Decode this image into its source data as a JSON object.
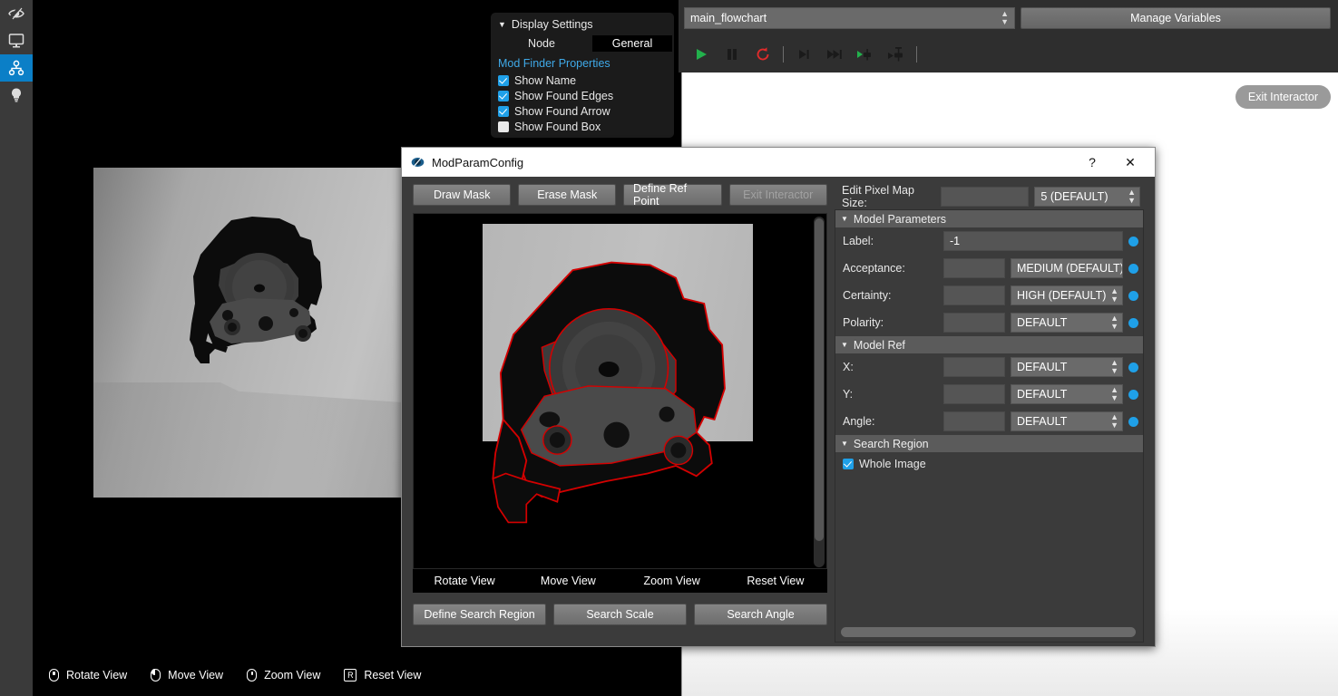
{
  "rail": {
    "items": [
      {
        "name": "vision-eye-icon",
        "label": "Vision",
        "active": false
      },
      {
        "name": "monitor-icon",
        "label": "Display",
        "active": false
      },
      {
        "name": "flowchart-nodes-icon",
        "label": "Flowchart",
        "active": true
      },
      {
        "name": "lightbulb-icon",
        "label": "Hints",
        "active": false
      }
    ]
  },
  "display_settings": {
    "title": "Display Settings",
    "triangle": "▼",
    "node_label": "Node",
    "general_tab": "General",
    "section_label": "Mod Finder Properties",
    "checkboxes": [
      {
        "label": "Show Name",
        "checked": true
      },
      {
        "label": "Show Found Edges",
        "checked": true
      },
      {
        "label": "Show Found Arrow",
        "checked": true
      },
      {
        "label": "Show Found Box",
        "checked": false
      }
    ]
  },
  "toolbar": {
    "flowchart_value": "main_flowchart",
    "manage_variables_label": "Manage Variables",
    "exit_interactor_label": "Exit Interactor",
    "buttons": [
      {
        "name": "run-button",
        "title": "Run"
      },
      {
        "name": "pause-button",
        "title": "Pause"
      },
      {
        "name": "reset-button",
        "title": "Reset"
      },
      {
        "name": "step-into-button",
        "title": "Step Into"
      },
      {
        "name": "step-over-button",
        "title": "Step Over"
      },
      {
        "name": "run-to-node-button",
        "title": "Run To Node"
      },
      {
        "name": "run-from-node-button",
        "title": "Run From Node"
      }
    ]
  },
  "viewport_legend": [
    {
      "icon": "mouse-rotate-icon",
      "label": "Rotate View"
    },
    {
      "icon": "mouse-move-icon",
      "label": "Move View"
    },
    {
      "icon": "mouse-zoom-icon",
      "label": "Zoom View"
    },
    {
      "icon": "key-r-icon",
      "label": "Reset View",
      "key": "R"
    }
  ],
  "dialog": {
    "title": "ModParamConfig",
    "icon": "eye-icon",
    "help_glyph": "?",
    "close_glyph": "✕",
    "tools": [
      {
        "label": "Draw Mask",
        "enabled": true
      },
      {
        "label": "Erase Mask",
        "enabled": true
      },
      {
        "label": "Define Ref Point",
        "enabled": true
      },
      {
        "label": "Exit Interactor",
        "enabled": false
      }
    ],
    "view_legend": [
      "Rotate View",
      "Move View",
      "Zoom View",
      "Reset View"
    ],
    "bottom_buttons": [
      "Define Search Region",
      "Search Scale",
      "Search Angle"
    ],
    "pixel_map": {
      "label": "Edit Pixel Map Size:",
      "text_value": "",
      "combo_value": "5 (DEFAULT)"
    },
    "sections": [
      {
        "name": "model-parameters",
        "title": "Model Parameters",
        "triangle": "▼",
        "rows": [
          {
            "label": "Label:",
            "kind": "text",
            "text_value": "-1",
            "dot": true
          },
          {
            "label": "Acceptance:",
            "kind": "combo",
            "text_value": "",
            "combo_value": "MEDIUM (DEFAULT)",
            "dot": true
          },
          {
            "label": "Certainty:",
            "kind": "combo",
            "text_value": "",
            "combo_value": "HIGH (DEFAULT)",
            "dot": true
          },
          {
            "label": "Polarity:",
            "kind": "combo",
            "text_value": "",
            "combo_value": "DEFAULT",
            "dot": true
          }
        ]
      },
      {
        "name": "model-ref",
        "title": "Model Ref",
        "triangle": "▼",
        "rows": [
          {
            "label": "X:",
            "kind": "combo",
            "text_value": "",
            "combo_value": "DEFAULT",
            "dot": true
          },
          {
            "label": "Y:",
            "kind": "combo",
            "text_value": "",
            "combo_value": "DEFAULT",
            "dot": true
          },
          {
            "label": "Angle:",
            "kind": "combo",
            "text_value": "",
            "combo_value": "DEFAULT",
            "dot": true
          }
        ]
      },
      {
        "name": "search-region",
        "title": "Search Region",
        "triangle": "▼",
        "checkbox": {
          "label": "Whole Image",
          "checked": true
        }
      }
    ]
  },
  "colors": {
    "accent_blue": "#1fa0e8",
    "rail_active": "#0b7fc7",
    "panel_bg": "#3b3b3b",
    "section_bg": "#5b5b5b",
    "run_green": "#22b14c",
    "reset_red": "#e02b2b",
    "edge_overlay_red": "#d40000"
  }
}
